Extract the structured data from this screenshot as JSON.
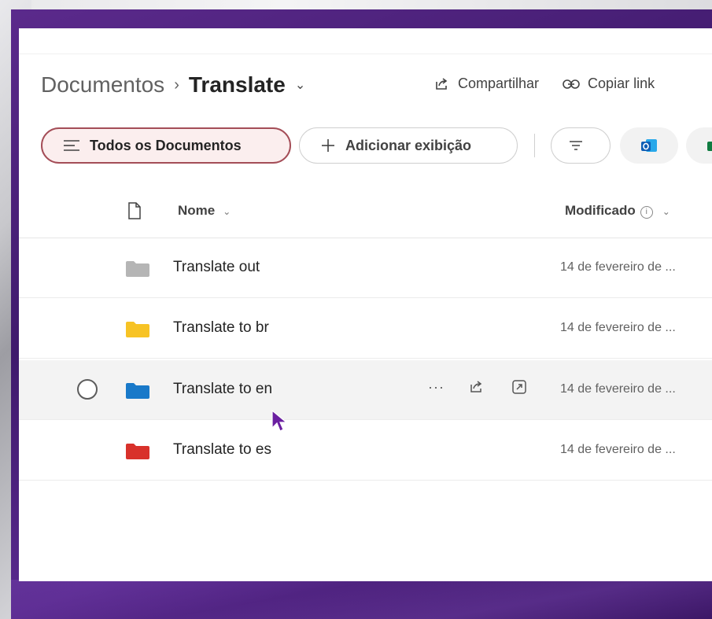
{
  "breadcrumb": {
    "parent": "Documentos",
    "separator": "›",
    "current": "Translate",
    "chevron": "⌄"
  },
  "actions": {
    "share": "Compartilhar",
    "copy_link": "Copiar link"
  },
  "views": {
    "all_documents": "Todos os Documentos",
    "add_view": "Adicionar exibição"
  },
  "apps": [
    "outlook-icon",
    "excel-icon"
  ],
  "columns": {
    "name": "Nome",
    "modified": "Modificado"
  },
  "rows": [
    {
      "name": "Translate out",
      "modified": "14 de fevereiro de ...",
      "folder_color": "#b5b5b5"
    },
    {
      "name": "Translate to br",
      "modified": "14 de fevereiro de ...",
      "folder_color": "#f7c325"
    },
    {
      "name": "Translate to en",
      "modified": "14 de fevereiro de ...",
      "folder_color": "#1979c9",
      "hovered": true
    },
    {
      "name": "Translate to es",
      "modified": "14 de fevereiro de ...",
      "folder_color": "#d8312b"
    }
  ],
  "row_actions": {
    "more": "···"
  },
  "colors": {
    "accent_border": "#a44d57",
    "accent_fill": "#fbeeee",
    "frame_purple": "#4a1f7a",
    "cursor": "#6a1fa0"
  }
}
